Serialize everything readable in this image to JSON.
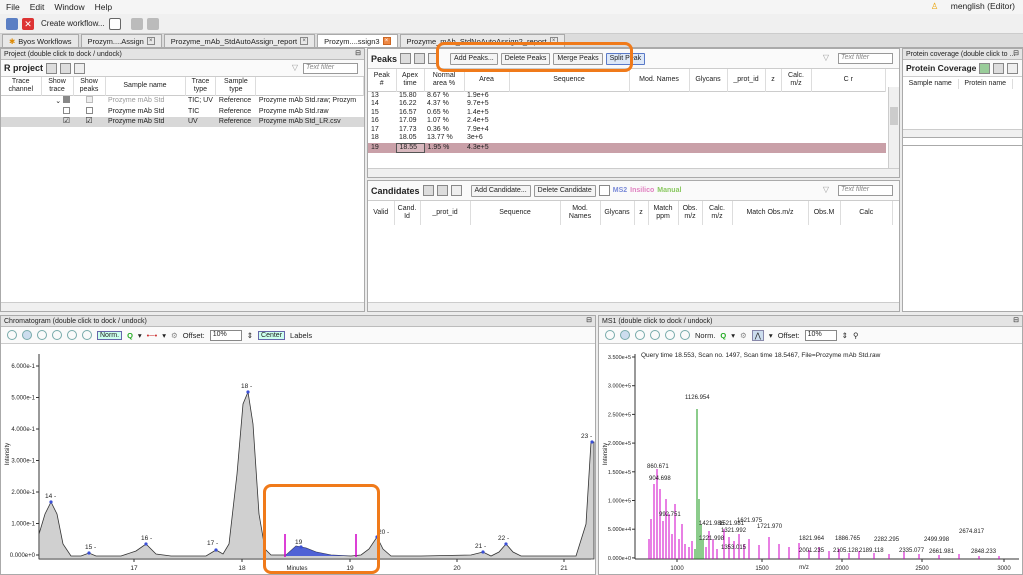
{
  "menu": [
    "File",
    "Edit",
    "Window",
    "Help"
  ],
  "user": "menglish (Editor)",
  "toolbar": {
    "create": "Create workflow..."
  },
  "tabs": [
    "Byos Workflows",
    "Prozym....Assign",
    "Prozyme_mAb_StdAutoAssign_report",
    "Prozym....ssign3",
    "Prozyme_mAb_StdNoAutoAssign2_report"
  ],
  "project": {
    "header": "Project (double click to dock / undock)",
    "title": "R project",
    "filter": "Text filter",
    "columns": [
      "Trace channel",
      "Show trace",
      "Show peaks",
      "Sample name",
      "Trace type",
      "Sample type",
      ""
    ],
    "rows": [
      [
        "",
        "",
        "",
        "Prozyme mAb Std",
        "TIC; UV",
        "Reference",
        "Prozyme mAb Std.raw; Prozym"
      ],
      [
        "",
        "",
        "",
        "Prozyme mAb Std",
        "TIC",
        "Reference",
        "Prozyme mAb Std.raw"
      ],
      [
        "",
        "",
        "",
        "Prozyme mAb Std",
        "UV",
        "Reference",
        "Prozyme mAb Std_LR.csv"
      ]
    ]
  },
  "peaks": {
    "title": "Peaks",
    "buttons": [
      "Add Peaks...",
      "Delete Peaks",
      "Merge Peaks",
      "Split Peak"
    ],
    "filter": "Text filter",
    "columns": [
      "Peak #",
      "Apex time",
      "Normal area %",
      "Area",
      "Sequence",
      "Mod. Names",
      "Glycans",
      "_prot_id",
      "z",
      "Calc. m/z",
      "C r"
    ],
    "rows": [
      [
        "13",
        "15.80",
        "8.67 %",
        "1.9e+6"
      ],
      [
        "14",
        "16.22",
        "4.37 %",
        "9.7e+5"
      ],
      [
        "15",
        "16.57",
        "0.65 %",
        "1.4e+5"
      ],
      [
        "16",
        "17.09",
        "1.07 %",
        "2.4e+5"
      ],
      [
        "17",
        "17.73",
        "0.36 %",
        "7.9e+4"
      ],
      [
        "18",
        "18.05",
        "13.77 %",
        "3e+6"
      ],
      [
        "19",
        "18.55",
        "1.95 %",
        "4.3e+5"
      ]
    ]
  },
  "candidates": {
    "title": "Candidates",
    "add": "Add Candidate...",
    "del": "Delete Candidate",
    "ms2": "MS2",
    "insilico": "Insilico",
    "manual": "Manual",
    "filter": "Text filter",
    "columns": [
      "Valid",
      "Cand. Id",
      "_prot_id",
      "Sequence",
      "Mod. Names",
      "Glycans",
      "z",
      "Match ppm",
      "Obs. m/z",
      "Calc. m/z",
      "Match Obs.m/z",
      "Obs.M",
      "Calc"
    ]
  },
  "coverage": {
    "header": "Protein coverage (double click to ...",
    "title": "Protein Coverage",
    "columns": [
      "Sample name",
      "Protein name"
    ]
  },
  "chrom": {
    "header": "Chromatogram (double click to dock / undock)",
    "norm": "Norm.",
    "offset_label": "Offset:",
    "offset": "10%",
    "center": "Center",
    "labels": "Labels",
    "xlabel": "Minutes",
    "ylabel": "Intensity",
    "yticks": [
      "6.000e-1",
      "5.000e-1",
      "4.000e-1",
      "3.000e-1",
      "2.000e-1",
      "1.000e-1",
      "0.000e+0"
    ],
    "xticks": [
      "17",
      "18",
      "19",
      "20",
      "21"
    ],
    "peak_labels": [
      "14 -",
      "15 -",
      "16 -",
      "17 -",
      "18 -",
      "19",
      "20 -",
      "21 -",
      "22 -",
      "23 -"
    ]
  },
  "ms1": {
    "header": "MS1 (double click to dock / undock)",
    "norm": "Norm.",
    "offset_label": "Offset:",
    "offset": "10%",
    "query": "Query time 18.553, Scan no. 1497, Scan time 18.5467, File=Prozyme mAb Std.raw",
    "xlabel": "m/z",
    "ylabel": "Intensity",
    "yticks": [
      "3.500e+5",
      "3.000e+5",
      "2.500e+5",
      "2.000e+5",
      "1.500e+5",
      "1.000e+5",
      "5.000e+4",
      "0.000e+0"
    ],
    "xticks": [
      "1000",
      "1500",
      "2000",
      "2500",
      "3000"
    ],
    "peak_labels": [
      "1126.954",
      "860.671",
      "904.698",
      "992.751",
      "1421.986",
      "1521.981",
      "1621.975",
      "1721.970",
      "1321.992",
      "1221.998",
      "1353.015",
      "1821.964",
      "1886.765",
      "2001.235",
      "2105.128",
      "2189.118",
      "2282.295",
      "2335.077",
      "2499.998",
      "2661.981",
      "2674.817",
      "2848.233"
    ]
  },
  "colors": {
    "accent": "#3a4fd6",
    "orange": "#f07a1a",
    "selrow": "#c9a0a8",
    "peakfill": "#cfcfcf",
    "magenta": "#d000c8",
    "green": "#1a9a1a"
  }
}
